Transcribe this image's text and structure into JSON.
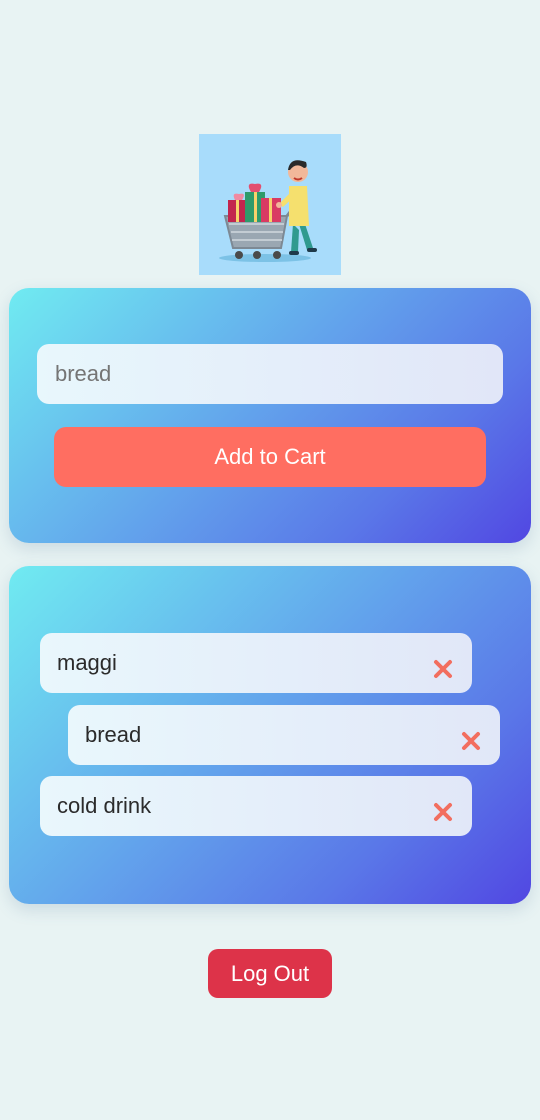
{
  "hero": {
    "image": "shopper-with-cart-illustration"
  },
  "form": {
    "input_value": "bread",
    "add_button_label": "Add to Cart"
  },
  "cart": {
    "items": [
      {
        "label": "maggi",
        "remove_icon": "close-x-icon"
      },
      {
        "label": "bread",
        "remove_icon": "close-x-icon"
      },
      {
        "label": "cold drink",
        "remove_icon": "close-x-icon"
      }
    ]
  },
  "logout_label": "Log Out",
  "colors": {
    "background": "#e8f3f3",
    "gradient_start": "#70ebf1",
    "gradient_end": "#5147e2",
    "accent": "#ff6e61",
    "remove_icon": "#f26e5f",
    "logout": "#dd3349"
  }
}
